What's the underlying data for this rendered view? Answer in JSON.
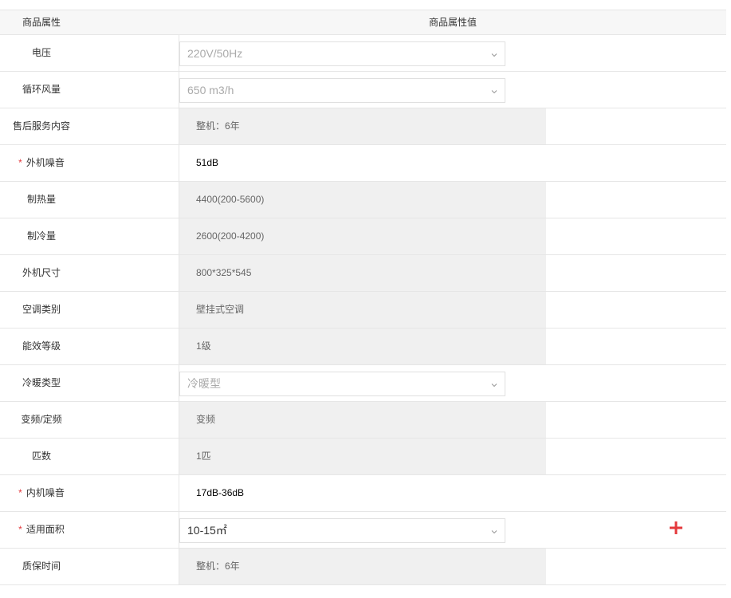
{
  "header": {
    "name_col": "商品属性",
    "value_col": "商品属性值"
  },
  "rows": [
    {
      "label": "电压",
      "value": "220V/50Hz",
      "kind": "select",
      "required": false
    },
    {
      "label": "循环风量",
      "value": "650 m3/h",
      "kind": "select",
      "required": false
    },
    {
      "label": "售后服务内容",
      "value": "整机：6年",
      "kind": "readonly",
      "required": false
    },
    {
      "label": "外机噪音",
      "value": "51dB",
      "kind": "plain",
      "required": true
    },
    {
      "label": "制热量",
      "value": "4400(200-5600)",
      "kind": "readonly",
      "required": false
    },
    {
      "label": "制冷量",
      "value": "2600(200-4200)",
      "kind": "readonly",
      "required": false
    },
    {
      "label": "外机尺寸",
      "value": "800*325*545",
      "kind": "readonly",
      "required": false
    },
    {
      "label": "空调类别",
      "value": "壁挂式空调",
      "kind": "readonly",
      "required": false
    },
    {
      "label": "能效等级",
      "value": "1级",
      "kind": "readonly",
      "required": false
    },
    {
      "label": "冷暖类型",
      "value": "冷暖型",
      "kind": "select",
      "required": false
    },
    {
      "label": "变频/定频",
      "value": "变频",
      "kind": "readonly",
      "required": false
    },
    {
      "label": "匹数",
      "value": "1匹",
      "kind": "readonly",
      "required": false
    },
    {
      "label": "内机噪音",
      "value": "17dB-36dB",
      "kind": "plain",
      "required": true
    },
    {
      "label": "适用面积",
      "value": "10-15㎡",
      "kind": "select-active",
      "required": true,
      "add_button": true
    },
    {
      "label": "质保时间",
      "value": "整机：6年",
      "kind": "readonly",
      "required": false
    }
  ],
  "required_mark": "*",
  "colors": {
    "required": "#e4393c",
    "add_button": "#e4393c",
    "readonly_bg": "#f0f0f0",
    "border": "#e6e6e6"
  }
}
